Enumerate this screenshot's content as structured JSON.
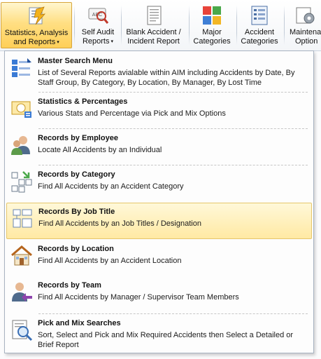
{
  "ribbon": {
    "buttons": [
      {
        "line1": "Statistics, Analysis",
        "line2": "and Reports",
        "has_dropdown": true,
        "active": true,
        "icon": "statistics-report-icon"
      },
      {
        "line1": "Self Audit",
        "line2": "Reports",
        "has_dropdown": true,
        "icon": "self-audit-icon"
      },
      {
        "line1": "Blank Accident /",
        "line2": "Incident Report",
        "icon": "blank-report-icon"
      },
      {
        "line1": "Major",
        "line2": "Categories",
        "icon": "major-categories-icon"
      },
      {
        "line1": "Accident",
        "line2": "Categories",
        "icon": "accident-categories-icon"
      },
      {
        "line1": "Maintena",
        "line2": "Option",
        "icon": "maintenance-icon"
      }
    ],
    "caret": "▾"
  },
  "menu": {
    "items": [
      {
        "title": "Master Search Menu",
        "description": "List of Several Reports avialable within AIM including Accidents by Date, By Staff Group, By Category, By Location, By Manager, By Lost Time",
        "icon": "master-search-icon"
      },
      {
        "title": "Statistics & Percentages",
        "description": "Various Stats and Percentage via Pick and Mix Options",
        "icon": "statistics-icon"
      },
      {
        "title": "Records by Employee",
        "description": "Locate All Accidents by an Individual",
        "icon": "employee-icon"
      },
      {
        "title": "Records by Category",
        "description": "Find All Accidents by an Accident Category",
        "icon": "category-icon"
      },
      {
        "title": "Records By Job Title",
        "description": "Find All Accidents by an Job Titles / Designation",
        "icon": "job-title-icon",
        "highlighted": true
      },
      {
        "title": "Records by Location",
        "description": "Find All Accidents by an Accident Location",
        "icon": "location-icon"
      },
      {
        "title": "Records by Team",
        "description": "Find All Accidents by Manager / Supervisor Team Members",
        "icon": "team-icon"
      },
      {
        "title": "Pick and Mix Searches",
        "description": "Sort, Select and Pick and Mix Required Accidents then Select a Detailed or Brief Report",
        "icon": "pick-and-mix-icon"
      }
    ]
  },
  "colors": {
    "active_button_bg": "#ffdf83",
    "highlight_bg": "#ffe9a3",
    "menu_border": "#a8b3c1"
  }
}
